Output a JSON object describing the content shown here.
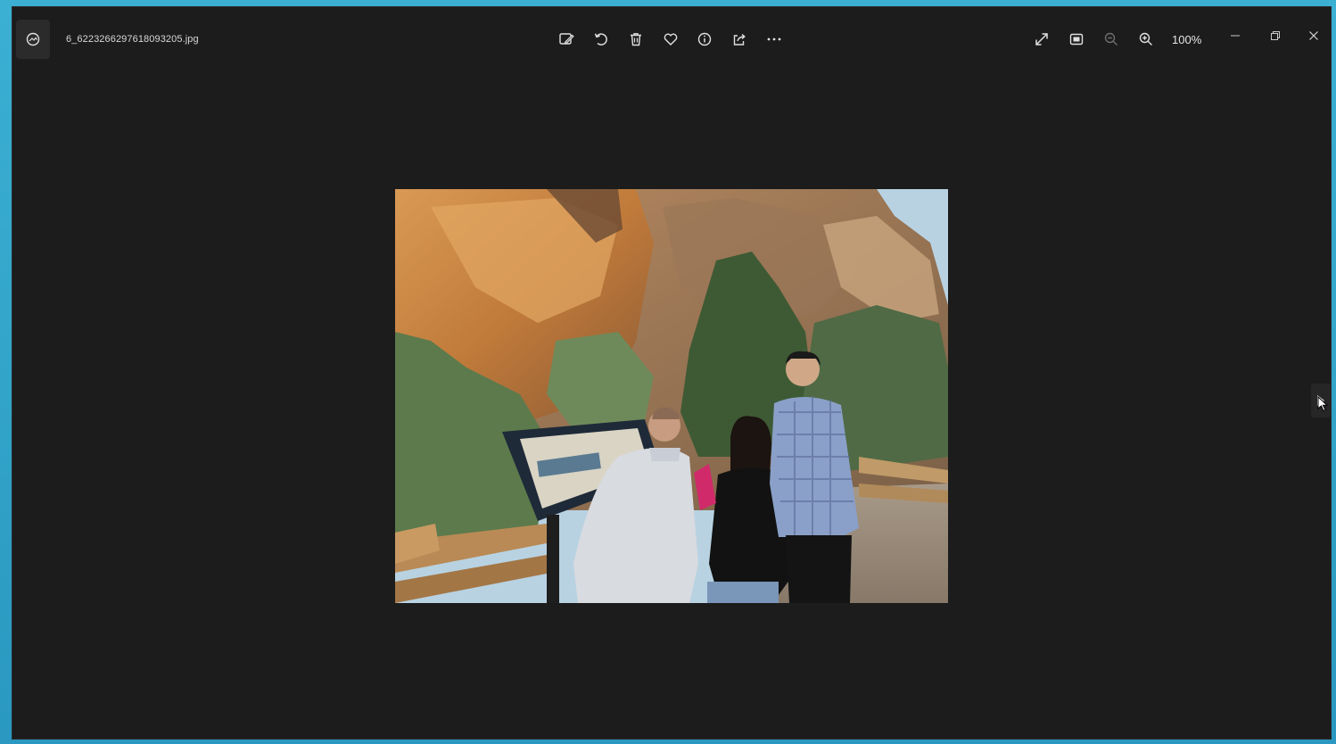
{
  "window": {
    "filename": "6_6223266297618093205.jpg"
  },
  "toolbar": {
    "icons": [
      "edit-image-icon",
      "rotate-icon",
      "delete-icon",
      "favorite-heart-icon",
      "info-icon",
      "share-icon",
      "more-options-icon"
    ]
  },
  "view": {
    "icons": [
      "fullscreen-icon",
      "fit-to-window-icon",
      "zoom-out-icon",
      "zoom-in-icon"
    ],
    "zoom_level": "100%"
  },
  "colors": {
    "window_bg": "#1c1c1c",
    "desktop_accent": "#2ea3c9",
    "icon": "#e0e0e0"
  }
}
